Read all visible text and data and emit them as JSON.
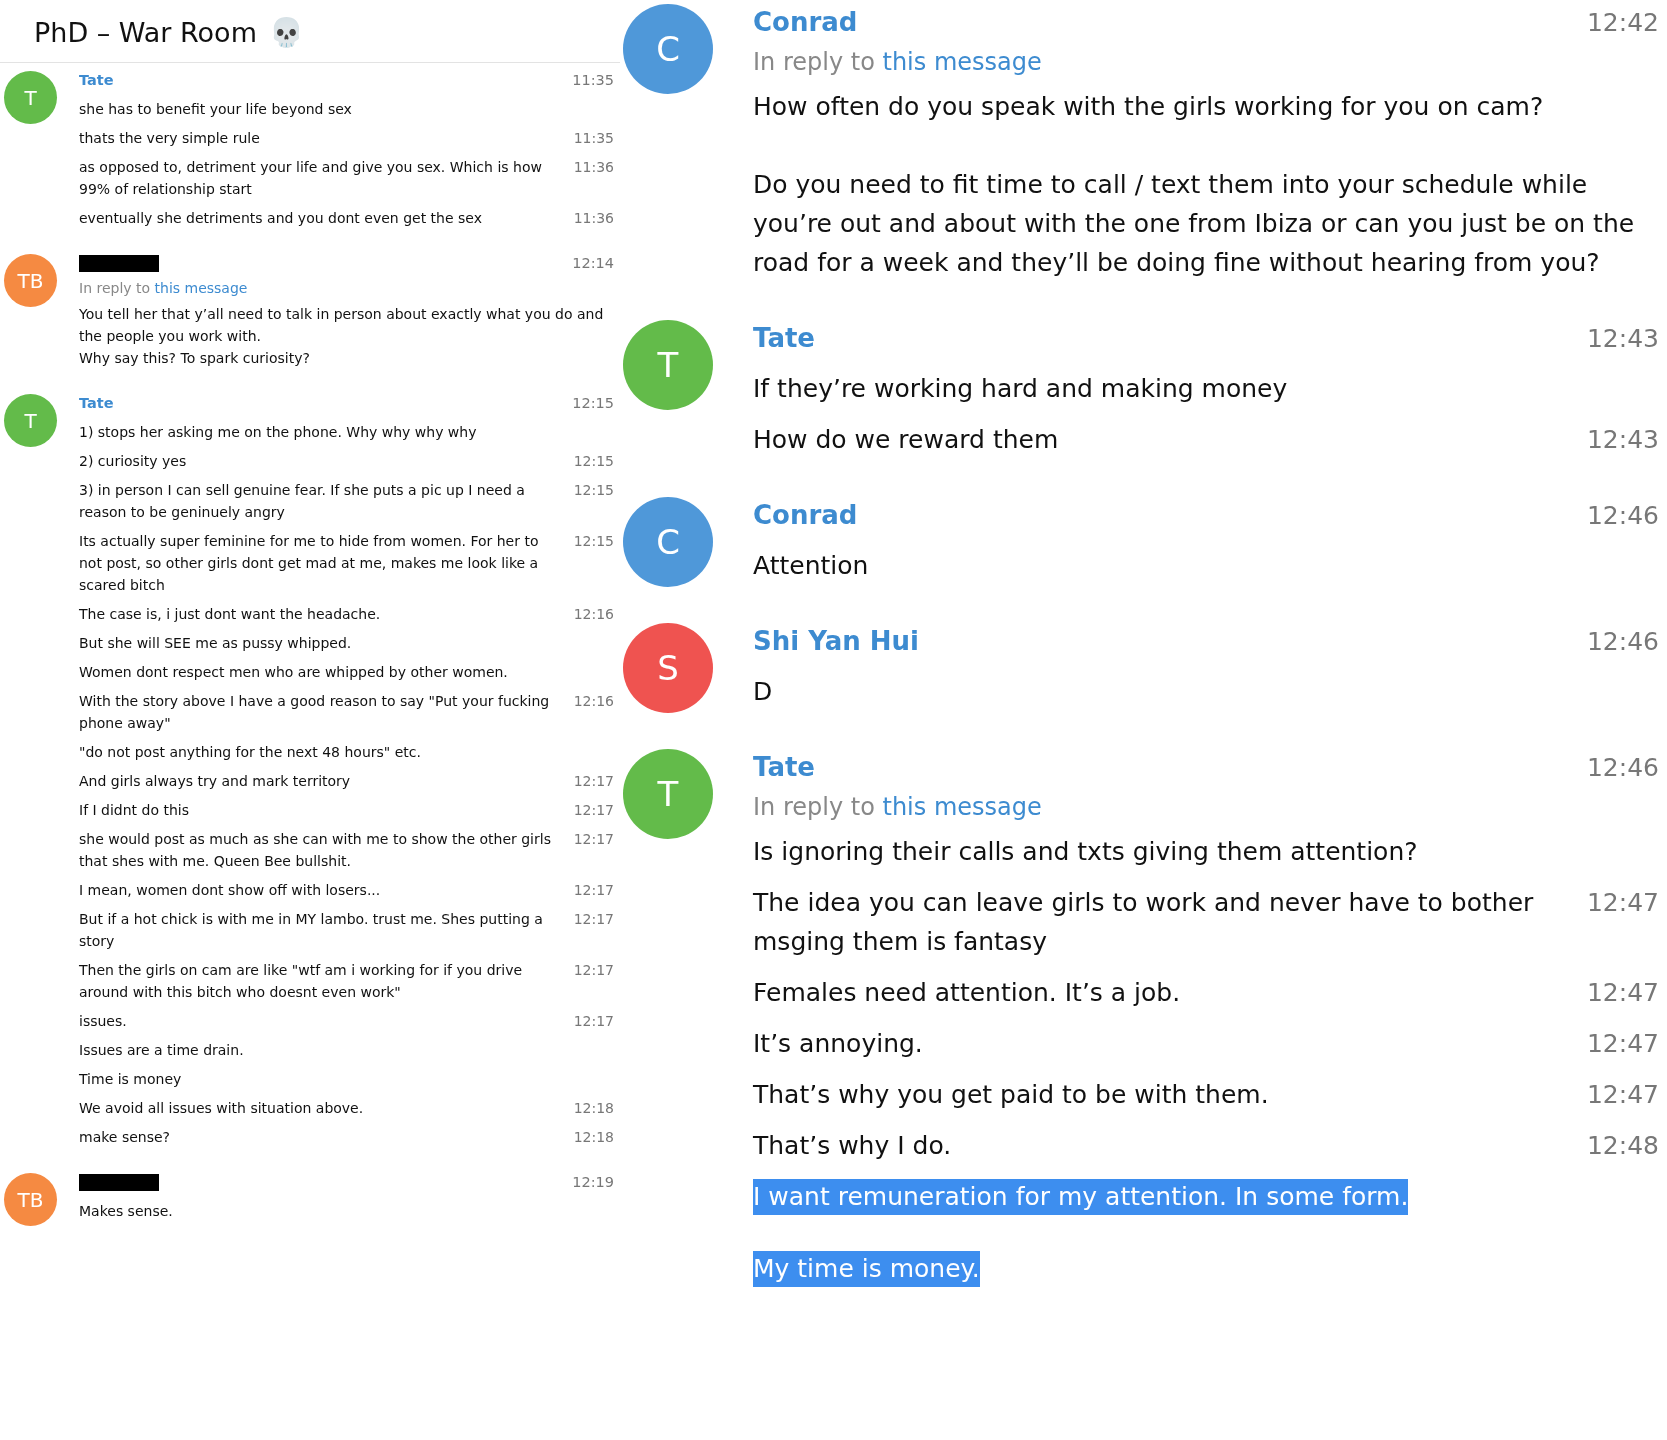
{
  "panels": [
    {
      "title": "PhD – War Room",
      "title_emoji": "💀",
      "groups": [
        {
          "avatar": "T",
          "color": "#63bb4a",
          "sender": "Tate",
          "time": "11:35",
          "messages": [
            {
              "text": "she has to benefit your life beyond sex"
            },
            {
              "text": "thats the very simple rule",
              "time": "11:35"
            },
            {
              "text": "as opposed to, detriment your life and give you sex. Which is how 99% of relationship start",
              "time": "11:36"
            },
            {
              "text": "eventually she detriments and you dont even get the sex",
              "time": "11:36"
            }
          ]
        },
        {
          "avatar": "TB",
          "color": "#f58a42",
          "sender_redacted": true,
          "time": "12:14",
          "reply": {
            "prefix": "In reply to",
            "link": "this message"
          },
          "messages": [
            {
              "text": "You tell her that y’all need to talk in person about exactly what you do and the people you work with.\nWhy say this? To spark curiosity?"
            }
          ]
        },
        {
          "avatar": "T",
          "color": "#63bb4a",
          "sender": "Tate",
          "time": "12:15",
          "messages": [
            {
              "text": "1) stops her asking me on the phone. Why why why why"
            },
            {
              "text": "2) curiosity yes",
              "time": "12:15"
            },
            {
              "text": "3) in person I can sell genuine fear. If she puts a pic up I need a reason to be geninuely angry",
              "time": "12:15"
            },
            {
              "text": "Its actually super feminine for me to hide from women. For her to not post, so other girls dont get mad at me, makes me look like a scared bitch",
              "time": "12:15"
            },
            {
              "text": "The case is, i just dont want the headache.",
              "time": "12:16"
            },
            {
              "text": "But she will SEE me as pussy whipped."
            },
            {
              "text": "Women dont respect men who are whipped by other women."
            },
            {
              "text": "With the story above I have a good reason to say \"Put your fucking phone away\"",
              "time": "12:16"
            },
            {
              "text": "\"do not post anything for the next 48 hours\" etc."
            },
            {
              "text": "And girls always try and mark territory",
              "time": "12:17"
            },
            {
              "text": "If I didnt do this",
              "time": "12:17"
            },
            {
              "text": "she would post as much as she can with me to show the other girls that shes with me. Queen Bee bullshit.",
              "time": "12:17"
            },
            {
              "text": "I mean, women dont show off with losers...",
              "time": "12:17"
            },
            {
              "text": "But if a hot chick is with me in MY lambo. trust me. Shes putting a story",
              "time": "12:17"
            },
            {
              "text": "Then the girls on cam are like \"wtf am i working for if you drive around with this bitch who doesnt even work\"",
              "time": "12:17"
            },
            {
              "text": "issues.",
              "time": "12:17"
            },
            {
              "text": "Issues are a time drain."
            },
            {
              "text": "Time is money"
            },
            {
              "text": "We avoid all issues with situation above.",
              "time": "12:18"
            },
            {
              "text": "make sense?",
              "time": "12:18"
            }
          ]
        },
        {
          "avatar": "TB",
          "color": "#f58a42",
          "sender_redacted": true,
          "time": "12:19",
          "messages": [
            {
              "text": "Makes sense."
            }
          ]
        }
      ]
    },
    {
      "groups": [
        {
          "avatar": "C",
          "color": "#4f98d9",
          "sender": "Conrad",
          "time": "12:42",
          "reply": {
            "prefix": "In reply to",
            "link": "this message"
          },
          "messages": [
            {
              "text": "How often do you speak with the girls working for you on cam?\n\nDo you need to fit time to call / text them into your schedule while you’re out and about with the one from Ibiza or can you just be on the road for a week and they’ll be doing fine without hearing from you?"
            }
          ]
        },
        {
          "avatar": "T",
          "color": "#63bb4a",
          "sender": "Tate",
          "time": "12:43",
          "messages": [
            {
              "text": "If they’re working hard and making money"
            },
            {
              "text": "How do we reward them",
              "time": "12:43"
            }
          ]
        },
        {
          "avatar": "C",
          "color": "#4f98d9",
          "sender": "Conrad",
          "time": "12:46",
          "messages": [
            {
              "text": "Attention"
            }
          ]
        },
        {
          "avatar": "S",
          "color": "#ef5350",
          "sender": "Shi Yan Hui",
          "time": "12:46",
          "messages": [
            {
              "text": "D"
            }
          ]
        },
        {
          "avatar": "T",
          "color": "#63bb4a",
          "sender": "Tate",
          "time": "12:46",
          "reply": {
            "prefix": "In reply to",
            "link": "this message"
          },
          "messages": [
            {
              "text": "Is ignoring their calls and txts giving them attention?",
              "highlighted": false
            },
            {
              "text": "The idea you can leave girls to work and never have to bother msging them is fantasy",
              "time": "12:47",
              "highlighted": false
            },
            {
              "text": "Females need attention. It’s a job.",
              "time": "12:47",
              "highlighted": false
            },
            {
              "text": "It’s annoying.",
              "time": "12:47",
              "highlighted": false
            },
            {
              "text": "That’s why you get paid to be with them.",
              "time": "12:47",
              "highlighted": false
            },
            {
              "text": "That’s why I do.",
              "time": "12:48",
              "highlighted": false
            },
            {
              "text": "I want remuneration for my attention. In some form.",
              "highlighted": true
            },
            {
              "text": "My time is money.",
              "highlighted": true
            }
          ]
        }
      ]
    }
  ]
}
